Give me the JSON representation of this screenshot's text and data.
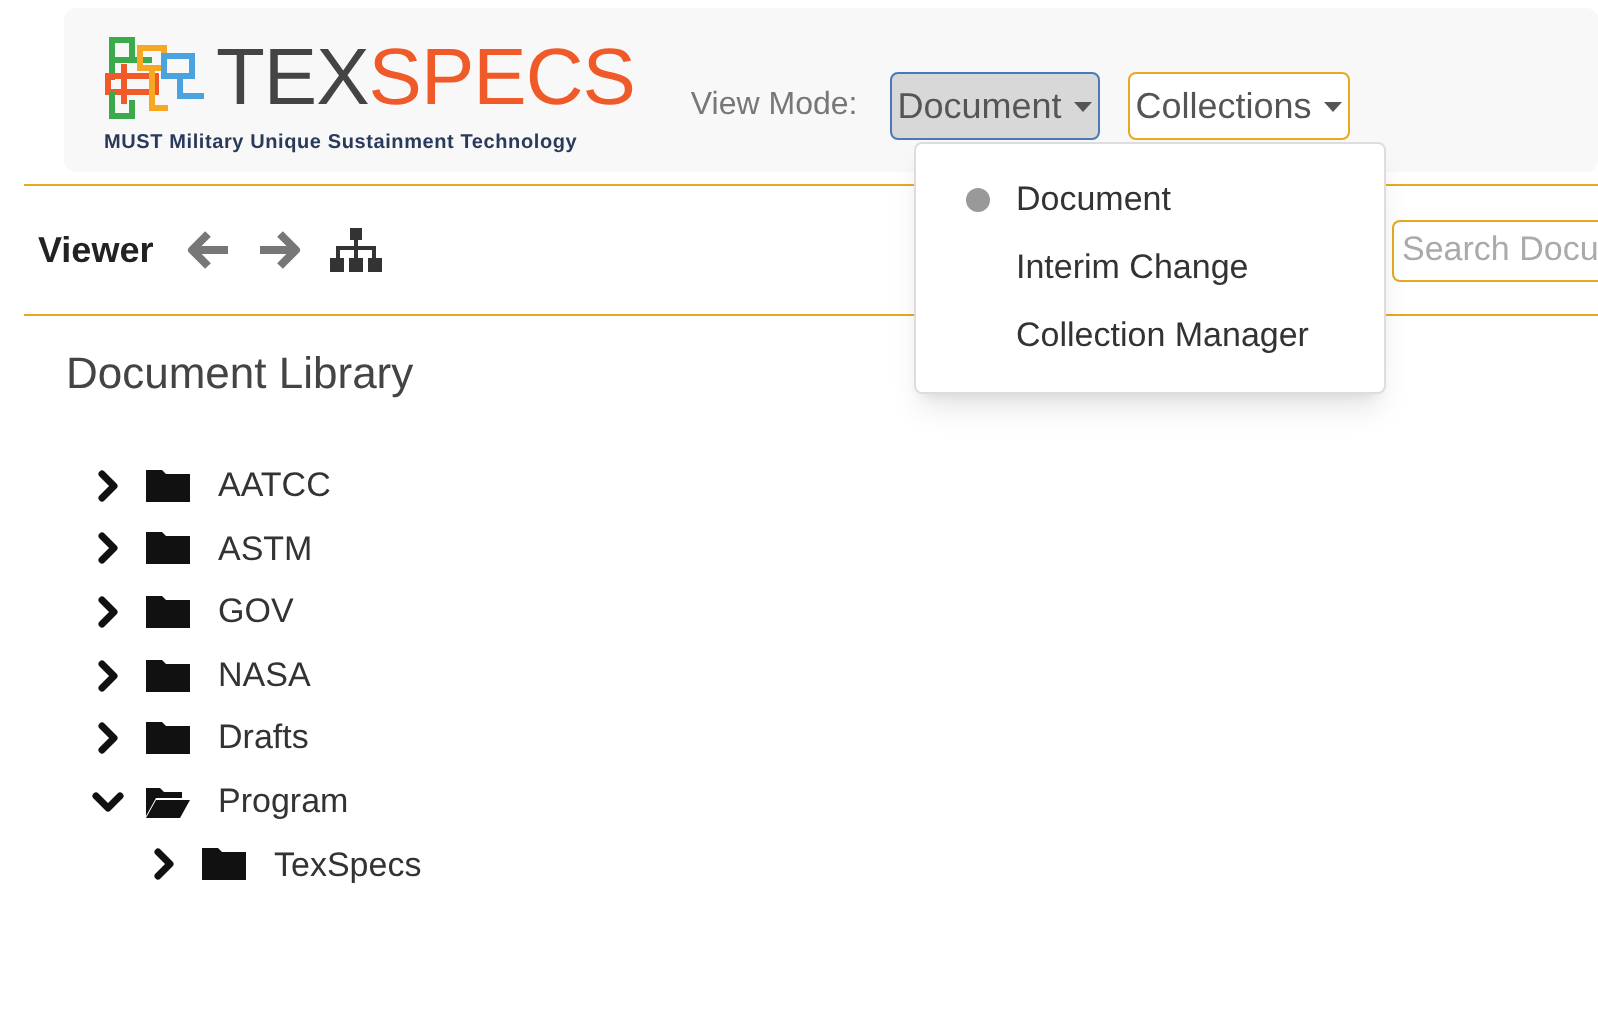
{
  "logo": {
    "wordmark_dark": "TEX",
    "wordmark_accent": "SPECS",
    "tagline": "MUST Military Unique Sustainment Technology"
  },
  "view_mode": {
    "label": "View Mode:",
    "dropdown": {
      "value": "Document",
      "expanded": true
    },
    "collections": {
      "value": "Collections",
      "expanded": false
    },
    "menu": [
      {
        "label": "Document",
        "selected": true
      },
      {
        "label": "Interim Change",
        "selected": false
      },
      {
        "label": "Collection Manager",
        "selected": false
      }
    ]
  },
  "toolbar": {
    "title": "Viewer",
    "search": {
      "placeholder": "Search Docu"
    }
  },
  "library": {
    "title": "Document Library",
    "tree": [
      {
        "label": "AATCC",
        "expanded": false
      },
      {
        "label": "ASTM",
        "expanded": false
      },
      {
        "label": "GOV",
        "expanded": false
      },
      {
        "label": "NASA",
        "expanded": false
      },
      {
        "label": "Drafts",
        "expanded": false
      },
      {
        "label": "Program",
        "expanded": true,
        "children": [
          {
            "label": "TexSpecs",
            "expanded": false
          }
        ]
      }
    ]
  }
}
